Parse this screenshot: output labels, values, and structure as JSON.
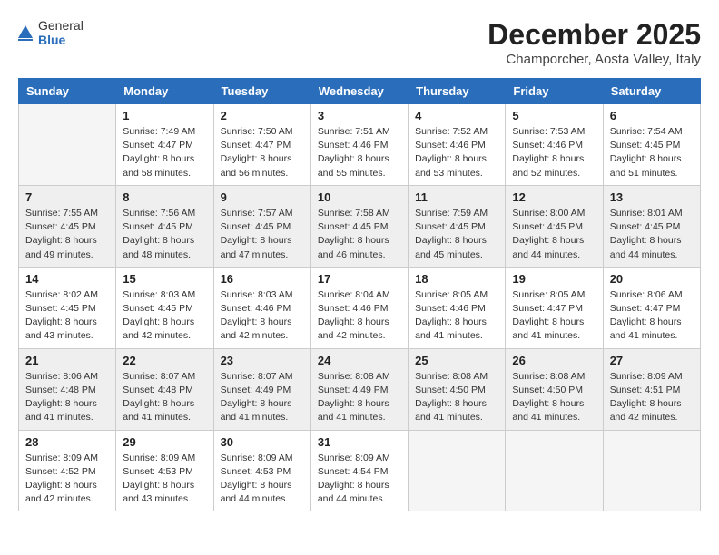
{
  "header": {
    "logo_general": "General",
    "logo_blue": "Blue",
    "month": "December 2025",
    "location": "Champorcher, Aosta Valley, Italy"
  },
  "weekdays": [
    "Sunday",
    "Monday",
    "Tuesday",
    "Wednesday",
    "Thursday",
    "Friday",
    "Saturday"
  ],
  "weeks": [
    [
      {
        "day": "",
        "info": ""
      },
      {
        "day": "1",
        "info": "Sunrise: 7:49 AM\nSunset: 4:47 PM\nDaylight: 8 hours\nand 58 minutes."
      },
      {
        "day": "2",
        "info": "Sunrise: 7:50 AM\nSunset: 4:47 PM\nDaylight: 8 hours\nand 56 minutes."
      },
      {
        "day": "3",
        "info": "Sunrise: 7:51 AM\nSunset: 4:46 PM\nDaylight: 8 hours\nand 55 minutes."
      },
      {
        "day": "4",
        "info": "Sunrise: 7:52 AM\nSunset: 4:46 PM\nDaylight: 8 hours\nand 53 minutes."
      },
      {
        "day": "5",
        "info": "Sunrise: 7:53 AM\nSunset: 4:46 PM\nDaylight: 8 hours\nand 52 minutes."
      },
      {
        "day": "6",
        "info": "Sunrise: 7:54 AM\nSunset: 4:45 PM\nDaylight: 8 hours\nand 51 minutes."
      }
    ],
    [
      {
        "day": "7",
        "info": "Sunrise: 7:55 AM\nSunset: 4:45 PM\nDaylight: 8 hours\nand 49 minutes."
      },
      {
        "day": "8",
        "info": "Sunrise: 7:56 AM\nSunset: 4:45 PM\nDaylight: 8 hours\nand 48 minutes."
      },
      {
        "day": "9",
        "info": "Sunrise: 7:57 AM\nSunset: 4:45 PM\nDaylight: 8 hours\nand 47 minutes."
      },
      {
        "day": "10",
        "info": "Sunrise: 7:58 AM\nSunset: 4:45 PM\nDaylight: 8 hours\nand 46 minutes."
      },
      {
        "day": "11",
        "info": "Sunrise: 7:59 AM\nSunset: 4:45 PM\nDaylight: 8 hours\nand 45 minutes."
      },
      {
        "day": "12",
        "info": "Sunrise: 8:00 AM\nSunset: 4:45 PM\nDaylight: 8 hours\nand 44 minutes."
      },
      {
        "day": "13",
        "info": "Sunrise: 8:01 AM\nSunset: 4:45 PM\nDaylight: 8 hours\nand 44 minutes."
      }
    ],
    [
      {
        "day": "14",
        "info": "Sunrise: 8:02 AM\nSunset: 4:45 PM\nDaylight: 8 hours\nand 43 minutes."
      },
      {
        "day": "15",
        "info": "Sunrise: 8:03 AM\nSunset: 4:45 PM\nDaylight: 8 hours\nand 42 minutes."
      },
      {
        "day": "16",
        "info": "Sunrise: 8:03 AM\nSunset: 4:46 PM\nDaylight: 8 hours\nand 42 minutes."
      },
      {
        "day": "17",
        "info": "Sunrise: 8:04 AM\nSunset: 4:46 PM\nDaylight: 8 hours\nand 42 minutes."
      },
      {
        "day": "18",
        "info": "Sunrise: 8:05 AM\nSunset: 4:46 PM\nDaylight: 8 hours\nand 41 minutes."
      },
      {
        "day": "19",
        "info": "Sunrise: 8:05 AM\nSunset: 4:47 PM\nDaylight: 8 hours\nand 41 minutes."
      },
      {
        "day": "20",
        "info": "Sunrise: 8:06 AM\nSunset: 4:47 PM\nDaylight: 8 hours\nand 41 minutes."
      }
    ],
    [
      {
        "day": "21",
        "info": "Sunrise: 8:06 AM\nSunset: 4:48 PM\nDaylight: 8 hours\nand 41 minutes."
      },
      {
        "day": "22",
        "info": "Sunrise: 8:07 AM\nSunset: 4:48 PM\nDaylight: 8 hours\nand 41 minutes."
      },
      {
        "day": "23",
        "info": "Sunrise: 8:07 AM\nSunset: 4:49 PM\nDaylight: 8 hours\nand 41 minutes."
      },
      {
        "day": "24",
        "info": "Sunrise: 8:08 AM\nSunset: 4:49 PM\nDaylight: 8 hours\nand 41 minutes."
      },
      {
        "day": "25",
        "info": "Sunrise: 8:08 AM\nSunset: 4:50 PM\nDaylight: 8 hours\nand 41 minutes."
      },
      {
        "day": "26",
        "info": "Sunrise: 8:08 AM\nSunset: 4:50 PM\nDaylight: 8 hours\nand 41 minutes."
      },
      {
        "day": "27",
        "info": "Sunrise: 8:09 AM\nSunset: 4:51 PM\nDaylight: 8 hours\nand 42 minutes."
      }
    ],
    [
      {
        "day": "28",
        "info": "Sunrise: 8:09 AM\nSunset: 4:52 PM\nDaylight: 8 hours\nand 42 minutes."
      },
      {
        "day": "29",
        "info": "Sunrise: 8:09 AM\nSunset: 4:53 PM\nDaylight: 8 hours\nand 43 minutes."
      },
      {
        "day": "30",
        "info": "Sunrise: 8:09 AM\nSunset: 4:53 PM\nDaylight: 8 hours\nand 44 minutes."
      },
      {
        "day": "31",
        "info": "Sunrise: 8:09 AM\nSunset: 4:54 PM\nDaylight: 8 hours\nand 44 minutes."
      },
      {
        "day": "",
        "info": ""
      },
      {
        "day": "",
        "info": ""
      },
      {
        "day": "",
        "info": ""
      }
    ]
  ]
}
